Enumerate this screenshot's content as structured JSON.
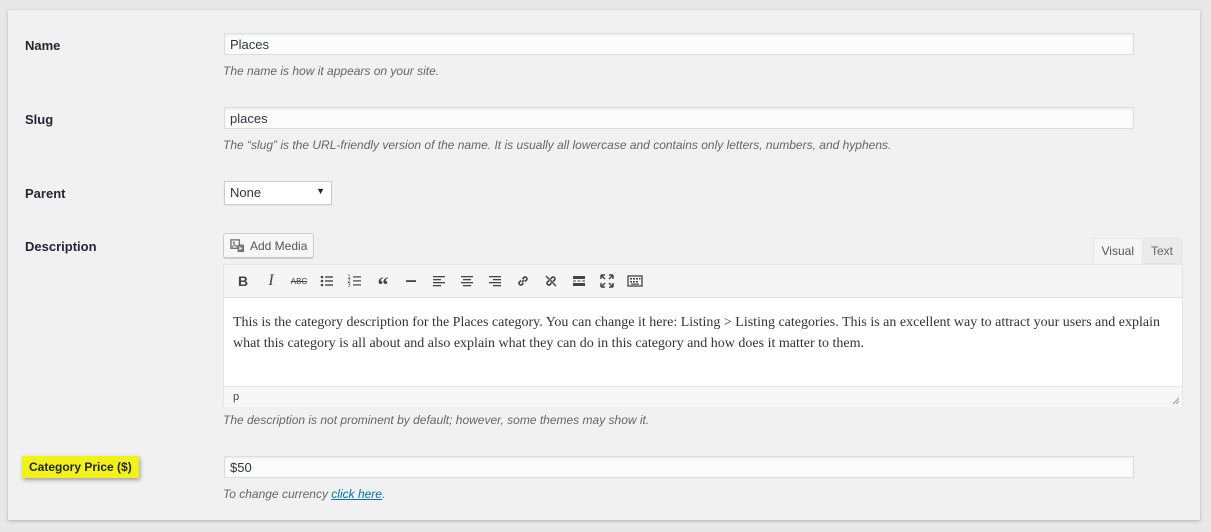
{
  "name": {
    "label": "Name",
    "value": "Places",
    "hint": "The name is how it appears on your site."
  },
  "slug": {
    "label": "Slug",
    "value": "places",
    "hint": "The “slug” is the URL-friendly version of the name. It is usually all lowercase and contains only letters, numbers, and hyphens."
  },
  "parent": {
    "label": "Parent",
    "selected": "None"
  },
  "description": {
    "label": "Description",
    "add_media": "Add Media",
    "tabs": {
      "visual": "Visual",
      "text": "Text"
    },
    "toolbar": [
      "bold-icon",
      "italic-icon",
      "strikethrough-icon",
      "bulleted-list-icon",
      "numbered-list-icon",
      "blockquote-icon",
      "horizontal-line-icon",
      "align-left-icon",
      "align-center-icon",
      "align-right-icon",
      "link-icon",
      "unlink-icon",
      "read-more-icon",
      "fullscreen-icon",
      "toolbar-toggle-icon"
    ],
    "content": "This is the category description for the Places category. You can change it here: Listing > Listing categories. This is an excellent way to attract your users and explain what this category is all about and also explain what they can do in this category and how does it matter to them.",
    "path": "p",
    "hint": "The description is not prominent by default; however, some themes may show it."
  },
  "price": {
    "label": "Category Price ($)",
    "value": "$50",
    "hint_prefix": "To change currency ",
    "hint_link": "click here",
    "hint_suffix": ".",
    "highlight_color": "#f2f21a"
  }
}
